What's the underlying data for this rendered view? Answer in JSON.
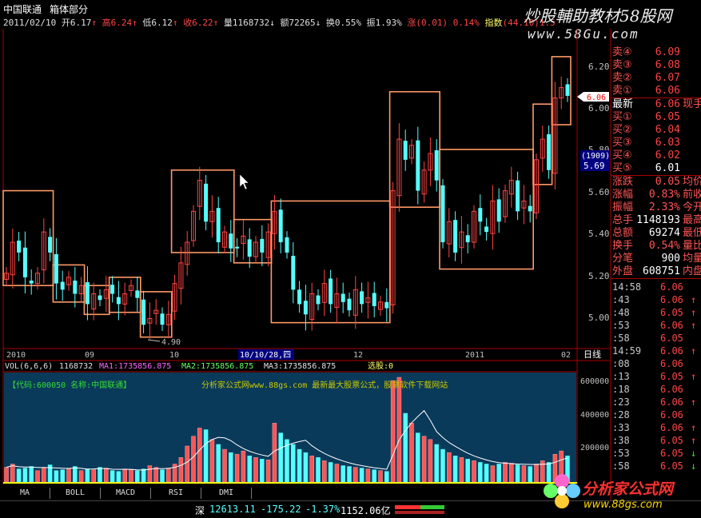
{
  "header": {
    "stock_name": "中国联通",
    "view_name": "箱体部分",
    "date": "2011/02/10",
    "open_label": "开",
    "open": "6.17",
    "high_label": "高",
    "high": "6.24",
    "low_label": "低",
    "low": "6.12",
    "close_label": "收",
    "close": "6.22",
    "vol_label": "量",
    "vol": "1168732",
    "amount_label": "额",
    "amount": "72265",
    "turnover_label": "换",
    "turnover": "0.55%",
    "amplitude_label": "振",
    "amplitude": "1.93%",
    "change_label": "涨",
    "change": "(0.01)",
    "change_pct": "0.14%",
    "index_label": "指数",
    "index": "(44.10)",
    "index_tail": "1.5"
  },
  "watermark": {
    "line1": "炒股輔助教材58股网",
    "line2": "www.58Gu.com"
  },
  "price_axis": {
    "ticks": [
      "6.20",
      "6.00",
      "5.80",
      "5.60",
      "5.40",
      "5.20",
      "5.00"
    ],
    "marker_last": "6.06",
    "marker_index": "(1909)",
    "marker_price": "5.69",
    "low_label": "4.90"
  },
  "date_axis": {
    "labels": [
      "2010",
      "09",
      "10",
      "10/10/28,四",
      "12",
      "2011",
      "02"
    ],
    "period": "日线"
  },
  "vol_header": {
    "name": "VOL(6,6,6)",
    "vol": "1168732",
    "ma1": "MA1:1735856.875",
    "ma2": "MA2:1735856.875",
    "ma3": "MA3:1735856.875",
    "pick": "选股:0"
  },
  "vol_info": {
    "code_text": "【代码:600050 名称:中国联通】",
    "site_text": "分析家公式网www.88gs.com 最新最大股票公式，股票软件下载网站"
  },
  "vol_axis": {
    "ticks": [
      "600000",
      "400000",
      "200000"
    ]
  },
  "tabs": [
    "MA",
    "BOLL",
    "MACD",
    "RSI",
    "DMI"
  ],
  "order_book": [
    {
      "label": "卖④",
      "value": "6.09",
      "extra": ""
    },
    {
      "label": "卖③",
      "value": "6.08",
      "extra": ""
    },
    {
      "label": "卖②",
      "value": "6.07",
      "extra": ""
    },
    {
      "label": "卖①",
      "value": "6.06",
      "extra": ""
    },
    {
      "label": "最新",
      "value": "6.06",
      "extra": "现手"
    },
    {
      "label": "买①",
      "value": "6.05",
      "extra": ""
    },
    {
      "label": "买②",
      "value": "6.04",
      "extra": ""
    },
    {
      "label": "买③",
      "value": "6.03",
      "extra": ""
    },
    {
      "label": "买④",
      "value": "6.02",
      "extra": ""
    },
    {
      "label": "买⑤",
      "value": "6.01",
      "extra": ""
    },
    {
      "label": "涨跌",
      "value": "0.05",
      "extra": "均价"
    },
    {
      "label": "涨幅",
      "value": "0.83%",
      "extra": "前收"
    },
    {
      "label": "振幅",
      "value": "2.33%",
      "extra": "今开"
    },
    {
      "label": "总手",
      "value": "1148193",
      "extra": "最高"
    },
    {
      "label": "总额",
      "value": "69274",
      "extra": "最低"
    },
    {
      "label": "换手",
      "value": "0.54%",
      "extra": "量比"
    },
    {
      "label": "分笔",
      "value": "900",
      "extra": "均量"
    },
    {
      "label": "外盘",
      "value": "608751",
      "extra": "内盘"
    }
  ],
  "ticks": [
    {
      "time": "14:58",
      "price": "6.06",
      "arrow": ""
    },
    {
      "time": ":43",
      "price": "6.06",
      "arrow": "↑"
    },
    {
      "time": ":48",
      "price": "6.05",
      "arrow": "↑"
    },
    {
      "time": ":53",
      "price": "6.06",
      "arrow": "↑"
    },
    {
      "time": ":58",
      "price": "6.05",
      "arrow": ""
    },
    {
      "time": "14:59",
      "price": "6.06",
      "arrow": "↑"
    },
    {
      "time": ":08",
      "price": "6.06",
      "arrow": ""
    },
    {
      "time": ":13",
      "price": "6.05",
      "arrow": "↑"
    },
    {
      "time": ":18",
      "price": "6.06",
      "arrow": ""
    },
    {
      "time": ":23",
      "price": "6.06",
      "arrow": "↑"
    },
    {
      "time": ":28",
      "price": "6.06",
      "arrow": ""
    },
    {
      "time": ":33",
      "price": "6.06",
      "arrow": "↑"
    },
    {
      "time": ":38",
      "price": "6.05",
      "arrow": "↑"
    },
    {
      "time": ":53",
      "price": "6.05",
      "arrow": "↓"
    },
    {
      "time": ":58",
      "price": "6.05",
      "arrow": "↓"
    }
  ],
  "status": {
    "market": "深",
    "index": "12613.11",
    "change": "-175.22",
    "pct": "-1.37%",
    "amount": "1152.06亿"
  },
  "ad": {
    "name": "分析家公式网",
    "url": "www.88gs.com"
  },
  "colors": {
    "up": "#ff4444",
    "down": "#55ffff",
    "box": "#ff9966",
    "axis": "#aa0000"
  },
  "chart_data": {
    "type": "candlestick",
    "ylim": [
      4.85,
      6.3
    ],
    "boxes": [
      {
        "i0": 0,
        "i1": 7,
        "lo": 5.14,
        "hi": 5.6
      },
      {
        "i0": 8,
        "i1": 12,
        "lo": 5.06,
        "hi": 5.24
      },
      {
        "i0": 13,
        "i1": 16,
        "lo": 5.0,
        "hi": 5.14
      },
      {
        "i0": 17,
        "i1": 21,
        "lo": 5.01,
        "hi": 5.18
      },
      {
        "i0": 22,
        "i1": 26,
        "lo": 4.89,
        "hi": 5.11
      },
      {
        "i0": 27,
        "i1": 36,
        "lo": 5.3,
        "hi": 5.7
      },
      {
        "i0": 37,
        "i1": 42,
        "lo": 5.25,
        "hi": 5.46
      },
      {
        "i0": 43,
        "i1": 61,
        "lo": 4.96,
        "hi": 5.55
      },
      {
        "i0": 62,
        "i1": 69,
        "lo": 5.52,
        "hi": 6.08
      },
      {
        "i0": 70,
        "i1": 84,
        "lo": 5.22,
        "hi": 5.8
      },
      {
        "i0": 85,
        "i1": 87,
        "lo": 5.63,
        "hi": 6.02
      },
      {
        "i0": 88,
        "i1": 90,
        "lo": 5.92,
        "hi": 6.25
      }
    ],
    "closes": [
      5.2,
      5.35,
      5.3,
      5.18,
      5.15,
      5.2,
      5.4,
      5.3,
      5.15,
      5.12,
      5.18,
      5.1,
      5.14,
      5.05,
      5.1,
      5.07,
      5.12,
      5.1,
      5.05,
      5.1,
      5.14,
      5.08,
      4.95,
      4.98,
      5.02,
      4.95,
      5.0,
      5.15,
      5.25,
      5.35,
      5.5,
      5.65,
      5.45,
      5.5,
      5.35,
      5.4,
      5.32,
      5.32,
      5.38,
      5.28,
      5.35,
      5.3,
      5.4,
      5.5,
      5.35,
      5.3,
      5.12,
      5.05,
      5.0,
      5.1,
      5.05,
      5.15,
      5.05,
      5.1,
      5.06,
      5.02,
      5.12,
      5.05,
      5.08,
      5.04,
      5.06,
      5.03,
      5.6,
      5.85,
      5.75,
      5.82,
      5.6,
      5.7,
      5.78,
      5.65,
      5.35,
      5.45,
      5.3,
      5.4,
      5.35,
      5.5,
      5.45,
      5.4,
      5.55,
      5.45,
      5.6,
      5.65,
      5.5,
      5.55,
      5.5,
      5.75,
      5.85,
      5.7,
      6.05,
      6.1,
      6.06
    ],
    "vol_ylim": [
      0,
      650000
    ],
    "volumes": [
      90000,
      110000,
      80000,
      85000,
      95000,
      70000,
      90000,
      105000,
      70000,
      75000,
      85000,
      95000,
      70000,
      80000,
      75000,
      90000,
      85000,
      70000,
      65000,
      80000,
      75000,
      70000,
      80000,
      100000,
      90000,
      75000,
      85000,
      110000,
      150000,
      220000,
      280000,
      330000,
      320000,
      260000,
      230000,
      200000,
      180000,
      170000,
      190000,
      160000,
      150000,
      140000,
      135000,
      360000,
      300000,
      260000,
      230000,
      200000,
      180000,
      160000,
      150000,
      130000,
      120000,
      110000,
      100000,
      95000,
      90000,
      85000,
      80000,
      75000,
      70000,
      65000,
      620000,
      640000,
      420000,
      360000,
      300000,
      280000,
      260000,
      230000,
      200000,
      180000,
      160000,
      150000,
      140000,
      130000,
      120000,
      110000,
      100000,
      110000,
      120000,
      115000,
      105000,
      100000,
      95000,
      110000,
      130000,
      120000,
      170000,
      190000,
      160000
    ]
  }
}
